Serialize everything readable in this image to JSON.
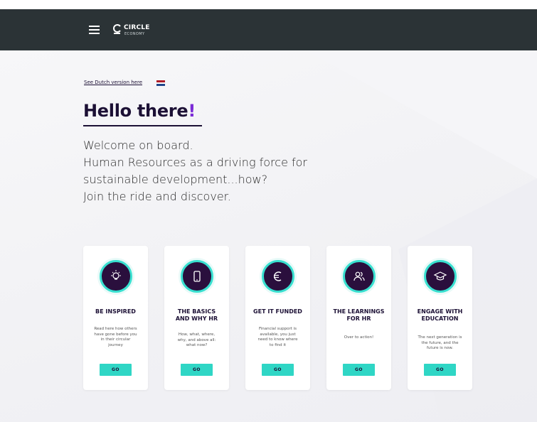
{
  "header": {
    "logo_name": "CIRCLE",
    "logo_sub": "ECONOMY",
    "bg_color": "#2b3336"
  },
  "intro": {
    "dutch_link": "See Dutch version here",
    "flag_colors": [
      "#ae1c28",
      "#ffffff",
      "#21468b"
    ],
    "heading_main": "Hello there",
    "heading_accent": "!",
    "welcome_lines": [
      "Welcome on board.",
      "Human Resources as a driving force for",
      "sustainable development...how?",
      "Join the ride and discover."
    ]
  },
  "colors": {
    "accent_teal": "#2fd6c5",
    "dark_purple": "#2a0f3d",
    "heading_purple": "#7b2bd6"
  },
  "cards": [
    {
      "icon": "lightbulb-icon",
      "title_lines": [
        "BE INSPIRED"
      ],
      "description": "Read here how others have gone before you in their circular journey",
      "button": "GO"
    },
    {
      "icon": "phone-icon",
      "title_lines": [
        "THE BASICS",
        "AND WHY HR"
      ],
      "description": "How, what, where, why, and above all: what now?",
      "button": "GO"
    },
    {
      "icon": "euro-icon",
      "title_lines": [
        "GET IT FUNDED"
      ],
      "description": "Financial support is available, you just need to know where to find it",
      "button": "GO"
    },
    {
      "icon": "people-icon",
      "title_lines": [
        "THE LEARNINGS",
        "FOR HR"
      ],
      "description": "Over to action!",
      "button": "GO"
    },
    {
      "icon": "graduation-cap-icon",
      "title_lines": [
        "ENGAGE WITH",
        "EDUCATION"
      ],
      "description": "The next generation is the future, and the future is now.",
      "button": "GO"
    }
  ]
}
